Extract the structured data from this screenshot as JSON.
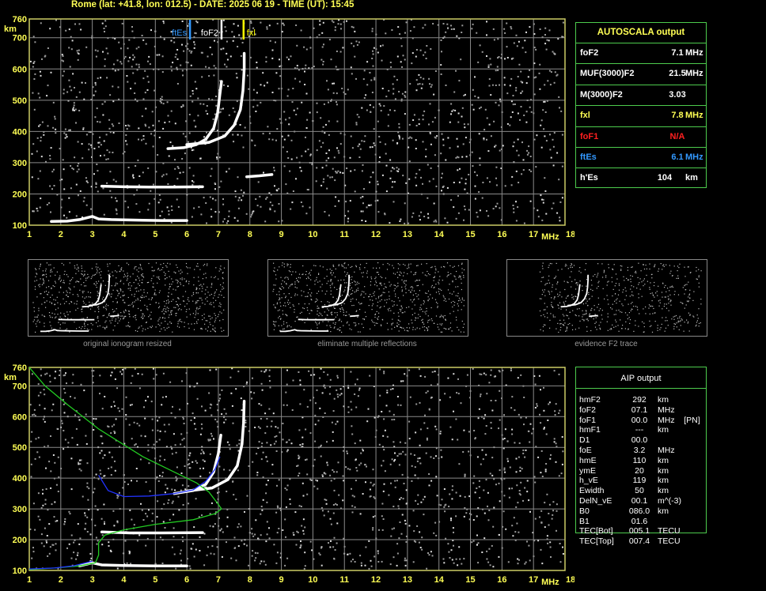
{
  "header": {
    "title": "Rome (lat: +41.8, lon: 012.5) - DATE: 2025 06 19 - TIME (UT): 15:45"
  },
  "colors": {
    "grid": "#8a8a8a",
    "frame": "#cccc66",
    "trace": "#ffffff",
    "noise": "#9a9a9a",
    "axis_label": "#ffff55",
    "fxl_marker": "#ffff00",
    "ftes_marker": "#3399ff",
    "fof2_marker": "#ffffff",
    "profile_green": "#22cc22",
    "profile_blue": "#2233ff",
    "panel_border": "#4dcc4d"
  },
  "chart_data": [
    {
      "id": "top",
      "type": "scatter",
      "title": "",
      "x_ticks": [
        "1",
        "2",
        "3",
        "4",
        "5",
        "6",
        "7",
        "8",
        "9",
        "10",
        "11",
        "12",
        "13",
        "14",
        "15",
        "16",
        "17",
        "18"
      ],
      "y_ticks": [
        "100",
        "200",
        "300",
        "400",
        "500",
        "600",
        "700",
        "760"
      ],
      "xlabel": "MHz",
      "ylabel": "km",
      "xlim": [
        1,
        18
      ],
      "ylim": [
        100,
        760
      ],
      "grid": true,
      "markers": [
        {
          "name": "ftEs",
          "freq": 6.1,
          "color": "#3399ff"
        },
        {
          "name": "foF2",
          "freq": 7.1,
          "color": "#ffffff"
        },
        {
          "name": "fxl",
          "freq": 7.8,
          "color": "#ffff00"
        }
      ],
      "traces": [
        {
          "name": "E-layer trace",
          "points": [
            [
              1.7,
              112
            ],
            [
              2.2,
              113
            ],
            [
              2.6,
              118
            ],
            [
              3.0,
              128
            ],
            [
              3.2,
              120
            ],
            [
              3.6,
              118
            ],
            [
              4.0,
              117
            ],
            [
              4.6,
              116
            ],
            [
              5.2,
              115
            ],
            [
              6.0,
              115
            ]
          ]
        },
        {
          "name": "Es second-hop trace",
          "points": [
            [
              3.3,
              225
            ],
            [
              4.0,
              223
            ],
            [
              4.8,
              222
            ],
            [
              5.6,
              222
            ],
            [
              6.5,
              223
            ]
          ]
        },
        {
          "name": "F2 ordinary trace",
          "points": [
            [
              5.4,
              345
            ],
            [
              5.9,
              348
            ],
            [
              6.3,
              358
            ],
            [
              6.6,
              375
            ],
            [
              6.85,
              410
            ],
            [
              6.98,
              460
            ],
            [
              7.05,
              520
            ],
            [
              7.1,
              560
            ]
          ]
        },
        {
          "name": "F2 extraordinary trace",
          "points": [
            [
              6.0,
              358
            ],
            [
              6.7,
              365
            ],
            [
              7.2,
              385
            ],
            [
              7.5,
              420
            ],
            [
              7.7,
              470
            ],
            [
              7.78,
              530
            ],
            [
              7.82,
              600
            ],
            [
              7.82,
              650
            ]
          ]
        },
        {
          "name": "second-hop fragment",
          "points": [
            [
              7.9,
              255
            ],
            [
              8.3,
              258
            ],
            [
              8.7,
              262
            ]
          ]
        }
      ]
    },
    {
      "id": "bottom",
      "type": "scatter",
      "title": "",
      "x_ticks": [
        "1",
        "2",
        "3",
        "4",
        "5",
        "6",
        "7",
        "8",
        "9",
        "10",
        "11",
        "12",
        "13",
        "14",
        "15",
        "16",
        "17",
        "18"
      ],
      "y_ticks": [
        "100",
        "200",
        "300",
        "400",
        "500",
        "600",
        "700",
        "760"
      ],
      "xlabel": "MHz",
      "ylabel": "km",
      "xlim": [
        1,
        18
      ],
      "ylim": [
        100,
        760
      ],
      "grid": true,
      "traces": [
        {
          "name": "E-layer trace",
          "points": [
            [
              2.6,
              115
            ],
            [
              3.0,
              125
            ],
            [
              3.3,
              118
            ],
            [
              4.0,
              116
            ],
            [
              5.0,
              115
            ],
            [
              6.0,
              115
            ]
          ]
        },
        {
          "name": "Es second-hop trace",
          "points": [
            [
              3.3,
              225
            ],
            [
              4.2,
              222
            ],
            [
              5.2,
              222
            ],
            [
              6.5,
              223
            ]
          ]
        },
        {
          "name": "F2 ordinary trace",
          "points": [
            [
              5.6,
              350
            ],
            [
              6.2,
              360
            ],
            [
              6.6,
              380
            ],
            [
              6.85,
              420
            ],
            [
              7.0,
              480
            ],
            [
              7.08,
              540
            ]
          ]
        },
        {
          "name": "F2 extraordinary trace",
          "points": [
            [
              6.0,
              358
            ],
            [
              6.8,
              368
            ],
            [
              7.3,
              395
            ],
            [
              7.6,
              440
            ],
            [
              7.75,
              510
            ],
            [
              7.8,
              580
            ],
            [
              7.82,
              650
            ]
          ]
        }
      ],
      "profiles": [
        {
          "name": "electron density profile",
          "color": "#22cc22",
          "points": [
            [
              1.0,
              760
            ],
            [
              1.5,
              700
            ],
            [
              2.2,
              640
            ],
            [
              3.2,
              560
            ],
            [
              4.6,
              470
            ],
            [
              5.6,
              420
            ],
            [
              6.3,
              385
            ],
            [
              6.7,
              355
            ],
            [
              7.0,
              315
            ],
            [
              7.1,
              300
            ],
            [
              6.9,
              285
            ],
            [
              6.2,
              265
            ],
            [
              5.0,
              250
            ],
            [
              4.0,
              232
            ],
            [
              3.4,
              215
            ],
            [
              3.2,
              190
            ],
            [
              3.2,
              150
            ],
            [
              3.1,
              125
            ],
            [
              2.6,
              115
            ],
            [
              1.8,
              108
            ],
            [
              1.0,
              103
            ]
          ]
        },
        {
          "name": "AIP fitted trace",
          "color": "#2233ff",
          "points": [
            [
              3.2,
              410
            ],
            [
              3.5,
              360
            ],
            [
              4.0,
              340
            ],
            [
              4.8,
              342
            ],
            [
              5.6,
              350
            ],
            [
              6.2,
              362
            ],
            [
              6.6,
              390
            ],
            [
              6.9,
              430
            ],
            [
              7.05,
              470
            ]
          ]
        },
        {
          "name": "AIP E trace",
          "color": "#2233ff",
          "points": [
            [
              1.0,
              105
            ],
            [
              1.8,
              108
            ],
            [
              2.4,
              115
            ],
            [
              3.0,
              130
            ]
          ]
        }
      ]
    }
  ],
  "thumbnails": [
    {
      "caption": "original ionogram resized"
    },
    {
      "caption": "eliminate multiple reflections"
    },
    {
      "caption": "evidence F2 trace"
    }
  ],
  "autoscala": {
    "title": "AUTOSCALA output",
    "rows": [
      {
        "label": "foF2",
        "value": "7.1",
        "unit": "MHz",
        "color": "#ffffff"
      },
      {
        "label": "MUF(3000)F2",
        "value": "21.5",
        "unit": "MHz",
        "color": "#ffffff"
      },
      {
        "label": "M(3000)F2",
        "value": "3.03",
        "unit": "",
        "color": "#ffffff"
      },
      {
        "label": "fxl",
        "value": "7.8",
        "unit": "MHz",
        "color": "#ffff55"
      },
      {
        "label": "foF1",
        "value": "N/A",
        "unit": "",
        "color": "#ff2020"
      },
      {
        "label": "ftEs",
        "value": "6.1",
        "unit": "MHz",
        "color": "#3399ff"
      },
      {
        "label": "h'Es",
        "value": "104",
        "unit": "km",
        "color": "#ffffff"
      }
    ]
  },
  "aip": {
    "title": "AIP output",
    "rows": [
      {
        "label": "hmF2",
        "value": "292",
        "unit": "km"
      },
      {
        "label": "foF2",
        "value": "07.1",
        "unit": "MHz"
      },
      {
        "label": "foF1",
        "value": "00.0",
        "unit": "MHz    [PN]"
      },
      {
        "label": "hmF1",
        "value": "---",
        "unit": "km"
      },
      {
        "label": "D1",
        "value": "00.0",
        "unit": ""
      },
      {
        "label": "foE",
        "value": "3.2",
        "unit": "MHz"
      },
      {
        "label": "hmE",
        "value": "110",
        "unit": "km"
      },
      {
        "label": "ymE",
        "value": "20",
        "unit": "km"
      },
      {
        "label": "h_vE",
        "value": "119",
        "unit": "km"
      },
      {
        "label": "Ewidth",
        "value": "50",
        "unit": "km"
      },
      {
        "label": "DelN_vE",
        "value": "00.1",
        "unit": "m^(-3)"
      },
      {
        "label": "B0",
        "value": "086.0",
        "unit": "km"
      },
      {
        "label": "B1",
        "value": "01.6",
        "unit": ""
      },
      {
        "label": "TEC[Bot]",
        "value": "005.1",
        "unit": "TECU"
      },
      {
        "label": "TEC[Top]",
        "value": "007.4",
        "unit": "TECU"
      }
    ]
  }
}
